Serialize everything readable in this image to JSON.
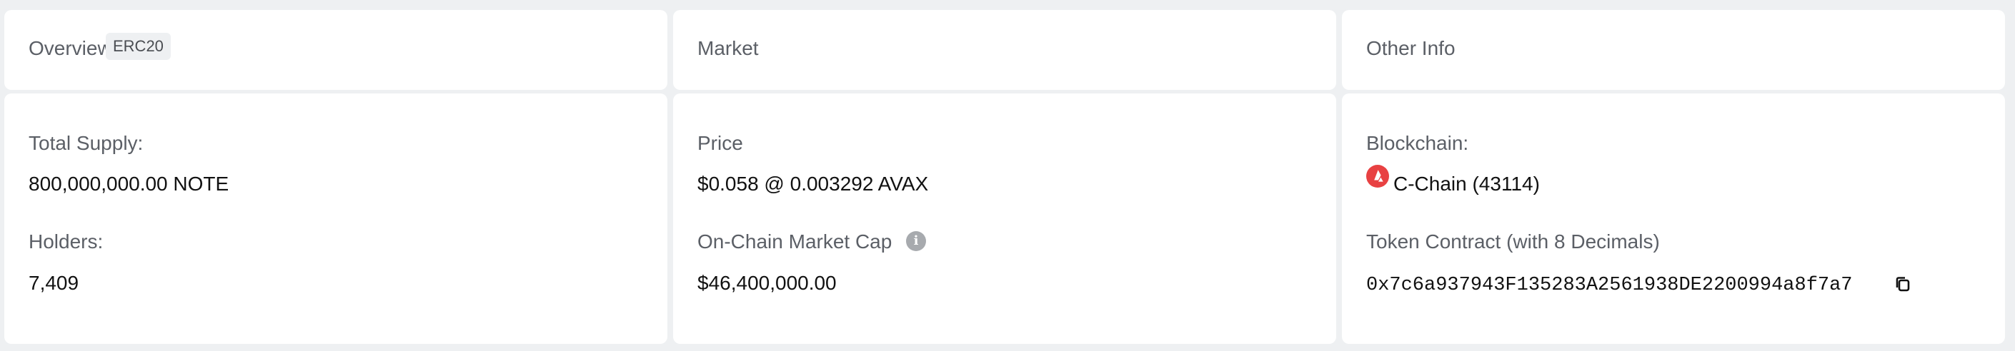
{
  "overview": {
    "title": "Overview",
    "badge": "ERC20",
    "total_supply_label": "Total Supply:",
    "total_supply_value": "800,000,000.00 NOTE",
    "holders_label": "Holders:",
    "holders_value": "7,409"
  },
  "market": {
    "title": "Market",
    "price_label": "Price",
    "price_value": "$0.058 @ 0.003292 AVAX",
    "market_cap_label": "On-Chain Market Cap",
    "market_cap_value": "$46,400,000.00",
    "info_icon": "info-icon"
  },
  "other_info": {
    "title": "Other Info",
    "blockchain_label": "Blockchain:",
    "blockchain_value": "C-Chain (43114)",
    "blockchain_icon": "avalanche-icon",
    "blockchain_icon_color": "#e84142",
    "contract_label": "Token Contract (with 8 Decimals)",
    "contract_address": "0x7c6a937943F135283A2561938DE2200994a8f7a7",
    "copy_icon": "copy-icon"
  }
}
